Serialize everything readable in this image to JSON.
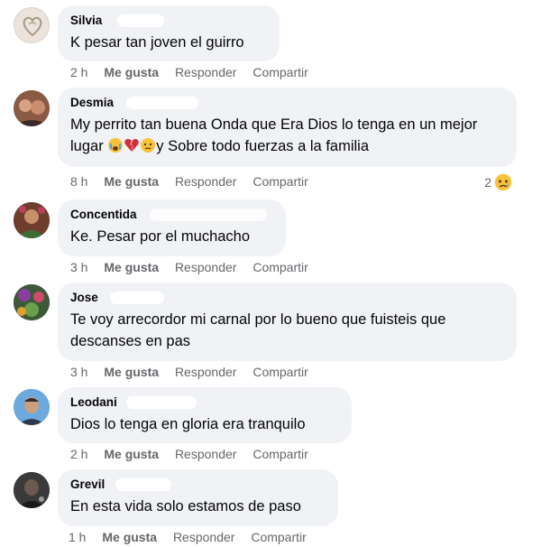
{
  "comments": [
    {
      "name": "Silvia",
      "text": "K pesar tan joven el guirro",
      "time": "2 h"
    },
    {
      "name": "Desmia",
      "text": "My perrito tan buena Onda que Era Dios lo tenga en un mejor lugar",
      "text_after": "y Sobre todo fuerzas a la familia",
      "time": "8 h",
      "reaction_count": "2"
    },
    {
      "name": "Concentida",
      "text": "Ke. Pesar por el muchacho",
      "time": "3 h"
    },
    {
      "name": "Jose",
      "text": "Te voy arrecordor mi carnal por lo bueno que fuisteis que descanses en pas",
      "time": "3 h"
    },
    {
      "name": "Leodani",
      "text": "Dios lo tenga en gloria era tranquilo",
      "time": "2 h"
    },
    {
      "name": "Grevil",
      "text": "En esta vida solo estamos de paso",
      "time": "1 h"
    }
  ],
  "actions": {
    "like": "Me gusta",
    "reply": "Responder",
    "share": "Compartir"
  },
  "colors": {
    "bubble": "#f0f2f5",
    "secondary_text": "#65676b",
    "text": "#050505"
  },
  "icons": [
    "avatar-image",
    "crying-face-icon",
    "broken-heart-icon",
    "sad-face-icon"
  ]
}
